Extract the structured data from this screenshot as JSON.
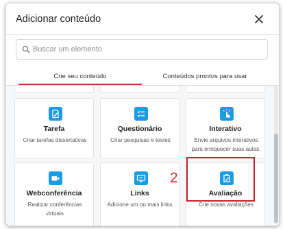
{
  "dialog": {
    "title": "Adicionar conteúdo"
  },
  "search": {
    "placeholder": "Buscar um elemento"
  },
  "tabs": [
    {
      "label": "Crie seu conteúdo",
      "active": true
    },
    {
      "label": "Conteúdos prontos para usar",
      "active": false
    }
  ],
  "cards": [
    {
      "title": "Tarefa",
      "description": "Criar tarefas dissertativas",
      "icon": "edit-document-icon"
    },
    {
      "title": "Questionário",
      "description": "Criar pesquisas e testes",
      "icon": "checklist-icon"
    },
    {
      "title": "Interativo",
      "description": "Envie arquivos interativos para enriquecer suas aulas.",
      "icon": "touch-pointer-icon"
    },
    {
      "title": "Webconferência",
      "description": "Realizar conferências virtuais",
      "icon": "video-camera-icon"
    },
    {
      "title": "Links",
      "description": "Adicione um ou mais links.",
      "icon": "monitor-link-icon"
    },
    {
      "title": "Avaliação",
      "description": "Crie novas avaliações",
      "icon": "clipboard-edit-icon"
    }
  ],
  "annotation": {
    "label": "2"
  },
  "colors": {
    "accent": "#1a9be3",
    "tab_underline": "#c0303a",
    "highlight": "#cc1f2b"
  }
}
